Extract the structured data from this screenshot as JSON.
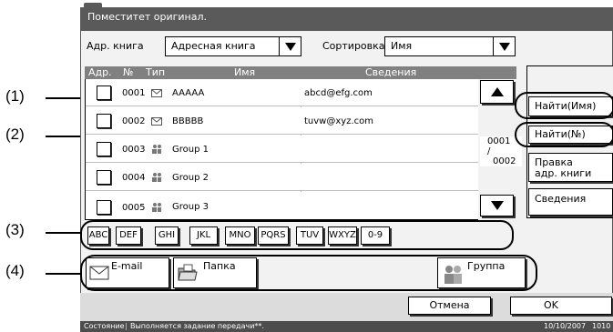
{
  "callouts": [
    "(1)",
    "(2)",
    "(3)",
    "(4)"
  ],
  "header": {
    "message": "Поместитет оригинал."
  },
  "toolbar": {
    "book_label": "Адр. книга",
    "book_value": "Адресная книга",
    "sort_label": "Сортировка",
    "sort_value": "Имя"
  },
  "table": {
    "headers": {
      "adr": "Адр.",
      "no": "№",
      "type": "Тип",
      "name": "Имя",
      "details": "Сведения"
    },
    "rows": [
      {
        "no": "0001",
        "type_icon": "envelope-icon",
        "name": "AAAAA",
        "details": "abcd@efg.com"
      },
      {
        "no": "0002",
        "type_icon": "envelope-icon",
        "name": "BBBBB",
        "details": "tuvw@xyz.com"
      },
      {
        "no": "0003",
        "type_icon": "group-icon",
        "name": "Group 1",
        "details": ""
      },
      {
        "no": "0004",
        "type_icon": "group-icon",
        "name": "Group 2",
        "details": ""
      },
      {
        "no": "0005",
        "type_icon": "group-icon",
        "name": "Group 3",
        "details": ""
      }
    ]
  },
  "pager": {
    "current": "0001",
    "sep": "/",
    "total": "0002"
  },
  "side_buttons": {
    "find_name": "Найти(Имя)",
    "find_no": "Найти(№)",
    "edit_line1": "Правка",
    "edit_line2": "адр. книги",
    "details": "Сведения"
  },
  "index_keys": [
    "ABC",
    "DEF",
    "GHI",
    "JKL",
    "MNO",
    "PQRS",
    "TUV",
    "WXYZ",
    "0-9"
  ],
  "dest_buttons": {
    "email": "E-mail",
    "folder": "Папка",
    "group": "Группа"
  },
  "footer": {
    "cancel": "Отмена",
    "ok": "OK"
  },
  "status": {
    "label": "Состояние",
    "text": "Выполняется задание передачи**.",
    "date": "10/10/2007",
    "time_partial": "1010"
  }
}
